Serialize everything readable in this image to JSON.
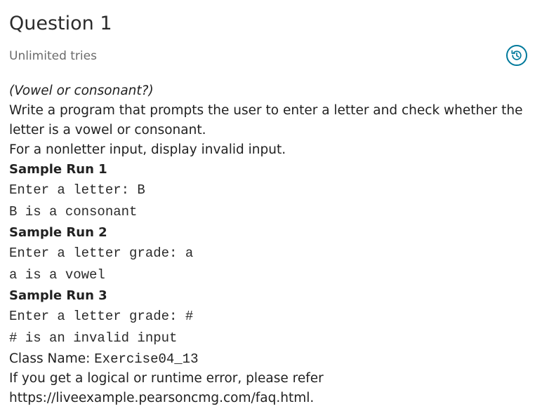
{
  "question": {
    "title": "Question 1",
    "tries": "Unlimited tries",
    "history_icon": "history-icon"
  },
  "body": {
    "topic": "(Vowel or consonant?)",
    "description_line1": "Write a program that prompts the user to enter a letter and check whether the",
    "description_line2": "letter is a vowel or consonant.",
    "description_line3": "For a nonletter input, display invalid input.",
    "runs": [
      {
        "heading": "Sample Run 1",
        "lines": [
          "Enter a letter: B",
          "B is a consonant"
        ]
      },
      {
        "heading": "Sample Run 2",
        "lines": [
          "Enter a letter grade: a",
          "a is a vowel"
        ]
      },
      {
        "heading": "Sample Run 3",
        "lines": [
          "Enter a letter grade: #",
          "# is an invalid input"
        ]
      }
    ],
    "class_name_label": "Class Name:",
    "class_name_value": "Exercise04_13",
    "help_line1": "If you get a logical or runtime error, please refer",
    "help_line2": "https://liveexample.pearsoncmg.com/faq.html."
  },
  "colors": {
    "accent": "#00799b"
  }
}
